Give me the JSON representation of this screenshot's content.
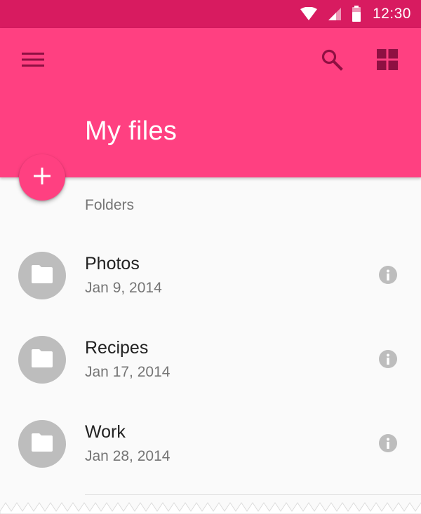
{
  "status_bar": {
    "time": "12:30",
    "icons": [
      "wifi-icon",
      "cell-signal-icon",
      "battery-icon"
    ],
    "background": "#d81b60"
  },
  "app_bar": {
    "title": "My files",
    "background": "#ff4081",
    "actions": [
      "menu-icon",
      "search-icon",
      "grid-view-icon"
    ]
  },
  "fab": {
    "icon": "add-icon",
    "label": "+"
  },
  "list": {
    "subheader": "Folders",
    "items": [
      {
        "name": "Photos",
        "date": "Jan 9, 2014",
        "icon": "folder-icon"
      },
      {
        "name": "Recipes",
        "date": "Jan 17, 2014",
        "icon": "folder-icon"
      },
      {
        "name": "Work",
        "date": "Jan 28, 2014",
        "icon": "folder-icon"
      }
    ]
  },
  "colors": {
    "accent": "#ff4081",
    "status": "#d81b60",
    "avatar": "#bdbdbd",
    "info_icon": "#bdbdbd",
    "primary_text": "#212121",
    "secondary_text": "#757575"
  }
}
